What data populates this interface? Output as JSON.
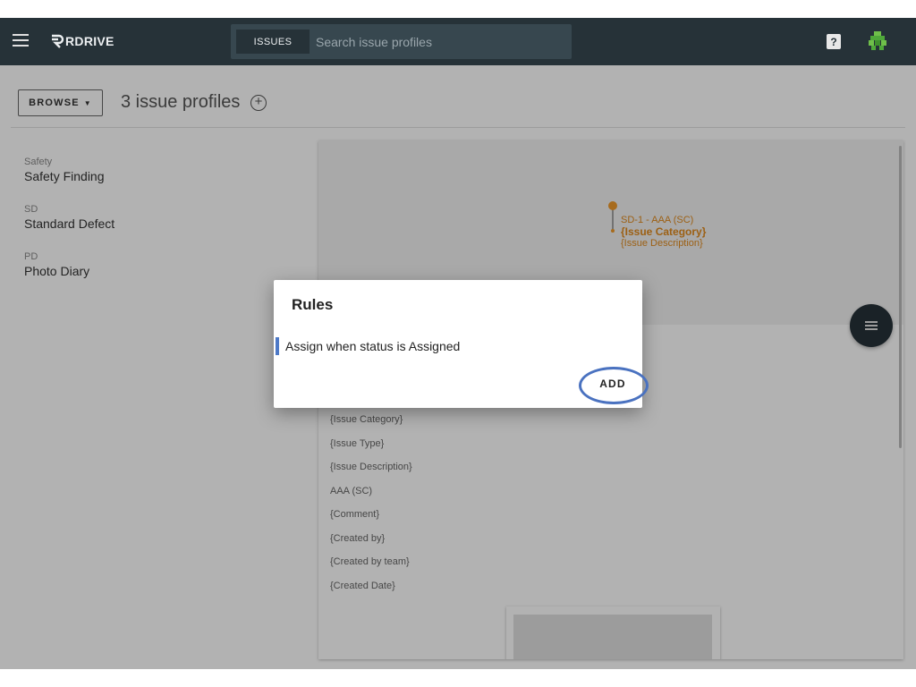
{
  "header": {
    "logo_text": "RDRIVE",
    "search_chip": "ISSUES",
    "search_placeholder": "Search issue profiles",
    "help_glyph": "?"
  },
  "toolbar": {
    "browse_label": "BROWSE",
    "profile_count_label": "3 issue profiles"
  },
  "profiles": [
    {
      "code": "Safety",
      "name": "Safety Finding"
    },
    {
      "code": "SD",
      "name": "Standard Defect"
    },
    {
      "code": "PD",
      "name": "Photo Diary"
    }
  ],
  "detail": {
    "pin_title": "SD-1 - AAA (SC)",
    "pin_category": "{Issue Category}",
    "pin_description": "{Issue Description}",
    "fields": [
      "{Issue Category}",
      "{Issue Type}",
      "{Issue Description}",
      "AAA (SC)",
      "{Comment}",
      "{Created by}",
      "{Created by team}",
      "{Created Date}"
    ]
  },
  "dialog": {
    "title": "Rules",
    "rule_text": "Assign when status is Assigned",
    "add_label": "ADD"
  },
  "colors": {
    "topbar": "#263238",
    "accent_orange": "#e08a1e",
    "highlight_blue": "#4a72c0"
  }
}
